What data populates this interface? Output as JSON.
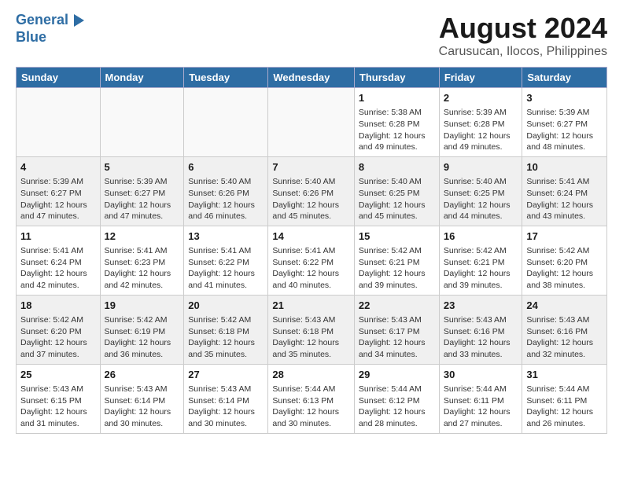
{
  "logo": {
    "line1": "General",
    "line2": "Blue"
  },
  "title": "August 2024",
  "subtitle": "Carusucan, Ilocos, Philippines",
  "days_of_week": [
    "Sunday",
    "Monday",
    "Tuesday",
    "Wednesday",
    "Thursday",
    "Friday",
    "Saturday"
  ],
  "weeks": [
    [
      {
        "day": "",
        "info": "",
        "empty": true
      },
      {
        "day": "",
        "info": "",
        "empty": true
      },
      {
        "day": "",
        "info": "",
        "empty": true
      },
      {
        "day": "",
        "info": "",
        "empty": true
      },
      {
        "day": "1",
        "info": "Sunrise: 5:38 AM\nSunset: 6:28 PM\nDaylight: 12 hours\nand 49 minutes."
      },
      {
        "day": "2",
        "info": "Sunrise: 5:39 AM\nSunset: 6:28 PM\nDaylight: 12 hours\nand 49 minutes."
      },
      {
        "day": "3",
        "info": "Sunrise: 5:39 AM\nSunset: 6:27 PM\nDaylight: 12 hours\nand 48 minutes."
      }
    ],
    [
      {
        "day": "4",
        "info": "Sunrise: 5:39 AM\nSunset: 6:27 PM\nDaylight: 12 hours\nand 47 minutes."
      },
      {
        "day": "5",
        "info": "Sunrise: 5:39 AM\nSunset: 6:27 PM\nDaylight: 12 hours\nand 47 minutes."
      },
      {
        "day": "6",
        "info": "Sunrise: 5:40 AM\nSunset: 6:26 PM\nDaylight: 12 hours\nand 46 minutes."
      },
      {
        "day": "7",
        "info": "Sunrise: 5:40 AM\nSunset: 6:26 PM\nDaylight: 12 hours\nand 45 minutes."
      },
      {
        "day": "8",
        "info": "Sunrise: 5:40 AM\nSunset: 6:25 PM\nDaylight: 12 hours\nand 45 minutes."
      },
      {
        "day": "9",
        "info": "Sunrise: 5:40 AM\nSunset: 6:25 PM\nDaylight: 12 hours\nand 44 minutes."
      },
      {
        "day": "10",
        "info": "Sunrise: 5:41 AM\nSunset: 6:24 PM\nDaylight: 12 hours\nand 43 minutes."
      }
    ],
    [
      {
        "day": "11",
        "info": "Sunrise: 5:41 AM\nSunset: 6:24 PM\nDaylight: 12 hours\nand 42 minutes."
      },
      {
        "day": "12",
        "info": "Sunrise: 5:41 AM\nSunset: 6:23 PM\nDaylight: 12 hours\nand 42 minutes."
      },
      {
        "day": "13",
        "info": "Sunrise: 5:41 AM\nSunset: 6:22 PM\nDaylight: 12 hours\nand 41 minutes."
      },
      {
        "day": "14",
        "info": "Sunrise: 5:41 AM\nSunset: 6:22 PM\nDaylight: 12 hours\nand 40 minutes."
      },
      {
        "day": "15",
        "info": "Sunrise: 5:42 AM\nSunset: 6:21 PM\nDaylight: 12 hours\nand 39 minutes."
      },
      {
        "day": "16",
        "info": "Sunrise: 5:42 AM\nSunset: 6:21 PM\nDaylight: 12 hours\nand 39 minutes."
      },
      {
        "day": "17",
        "info": "Sunrise: 5:42 AM\nSunset: 6:20 PM\nDaylight: 12 hours\nand 38 minutes."
      }
    ],
    [
      {
        "day": "18",
        "info": "Sunrise: 5:42 AM\nSunset: 6:20 PM\nDaylight: 12 hours\nand 37 minutes."
      },
      {
        "day": "19",
        "info": "Sunrise: 5:42 AM\nSunset: 6:19 PM\nDaylight: 12 hours\nand 36 minutes."
      },
      {
        "day": "20",
        "info": "Sunrise: 5:42 AM\nSunset: 6:18 PM\nDaylight: 12 hours\nand 35 minutes."
      },
      {
        "day": "21",
        "info": "Sunrise: 5:43 AM\nSunset: 6:18 PM\nDaylight: 12 hours\nand 35 minutes."
      },
      {
        "day": "22",
        "info": "Sunrise: 5:43 AM\nSunset: 6:17 PM\nDaylight: 12 hours\nand 34 minutes."
      },
      {
        "day": "23",
        "info": "Sunrise: 5:43 AM\nSunset: 6:16 PM\nDaylight: 12 hours\nand 33 minutes."
      },
      {
        "day": "24",
        "info": "Sunrise: 5:43 AM\nSunset: 6:16 PM\nDaylight: 12 hours\nand 32 minutes."
      }
    ],
    [
      {
        "day": "25",
        "info": "Sunrise: 5:43 AM\nSunset: 6:15 PM\nDaylight: 12 hours\nand 31 minutes."
      },
      {
        "day": "26",
        "info": "Sunrise: 5:43 AM\nSunset: 6:14 PM\nDaylight: 12 hours\nand 30 minutes."
      },
      {
        "day": "27",
        "info": "Sunrise: 5:43 AM\nSunset: 6:14 PM\nDaylight: 12 hours\nand 30 minutes."
      },
      {
        "day": "28",
        "info": "Sunrise: 5:44 AM\nSunset: 6:13 PM\nDaylight: 12 hours\nand 30 minutes."
      },
      {
        "day": "29",
        "info": "Sunrise: 5:44 AM\nSunset: 6:12 PM\nDaylight: 12 hours\nand 28 minutes."
      },
      {
        "day": "30",
        "info": "Sunrise: 5:44 AM\nSunset: 6:11 PM\nDaylight: 12 hours\nand 27 minutes."
      },
      {
        "day": "31",
        "info": "Sunrise: 5:44 AM\nSunset: 6:11 PM\nDaylight: 12 hours\nand 26 minutes."
      }
    ]
  ]
}
